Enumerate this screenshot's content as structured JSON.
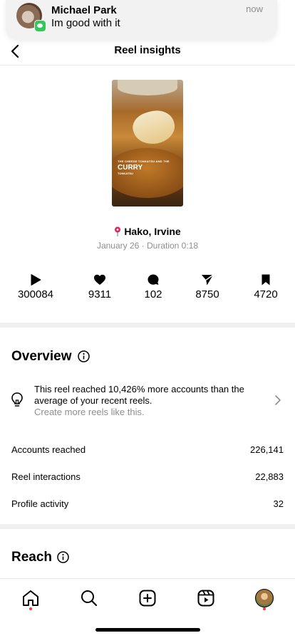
{
  "notification": {
    "sender": "Michael Park",
    "message": "Im good with it",
    "time": "now"
  },
  "header": {
    "title": "Reel insights"
  },
  "reel": {
    "caption_top": "THE CHEESE TONKATSU AND THE",
    "caption_main": "CURRY",
    "caption_sub": "TONKATSU",
    "location": "Hako, Irvine",
    "meta": "January 26 · Duration 0:18"
  },
  "stats": [
    {
      "icon": "play-icon",
      "value": "300084"
    },
    {
      "icon": "heart-icon",
      "value": "9311"
    },
    {
      "icon": "comment-icon",
      "value": "102"
    },
    {
      "icon": "share-icon",
      "value": "8750"
    },
    {
      "icon": "bookmark-icon",
      "value": "4720"
    }
  ],
  "overview": {
    "title": "Overview",
    "insight_text": "This reel reached 10,426% more accounts than the average of your recent reels.",
    "insight_sub": "Create more reels like this.",
    "metrics": [
      {
        "label": "Accounts reached",
        "value": "226,141"
      },
      {
        "label": "Reel interactions",
        "value": "22,883"
      },
      {
        "label": "Profile activity",
        "value": "32"
      }
    ]
  },
  "reach": {
    "title": "Reach"
  },
  "nav": {
    "items": [
      "home-icon",
      "search-icon",
      "create-icon",
      "reels-icon",
      "profile-avatar"
    ],
    "dot_color": "#ff3040"
  }
}
